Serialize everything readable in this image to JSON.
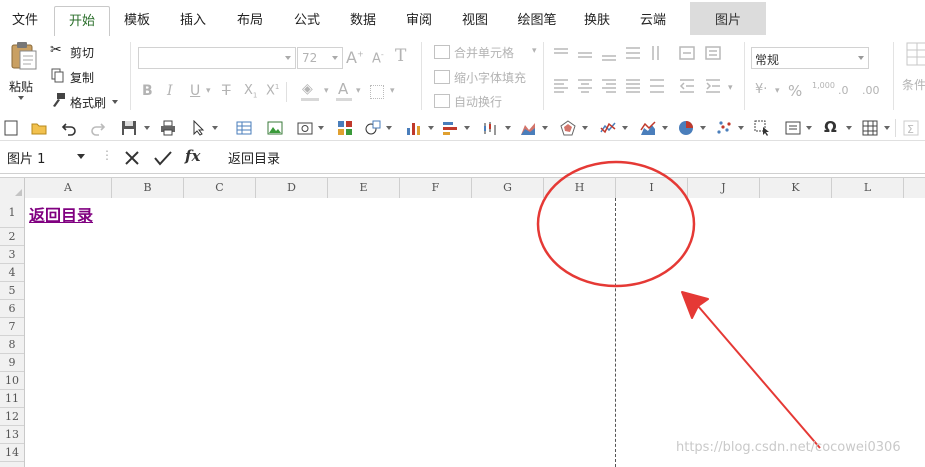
{
  "tabs": [
    {
      "label": "文件",
      "active": false
    },
    {
      "label": "开始",
      "active": true
    },
    {
      "label": "模板",
      "active": false
    },
    {
      "label": "插入",
      "active": false
    },
    {
      "label": "布局",
      "active": false
    },
    {
      "label": "公式",
      "active": false
    },
    {
      "label": "数据",
      "active": false
    },
    {
      "label": "审阅",
      "active": false
    },
    {
      "label": "视图",
      "active": false
    },
    {
      "label": "绘图笔",
      "active": false
    },
    {
      "label": "换肤",
      "active": false
    },
    {
      "label": "云端",
      "active": false
    }
  ],
  "context_tab": "图片",
  "clipboard": {
    "paste": "粘贴",
    "cut": "剪切",
    "copy": "复制",
    "format_painter": "格式刷"
  },
  "font": {
    "size_placeholder": "72"
  },
  "alignment": {
    "merge": "合并单元格",
    "shrink": "缩小字体填充",
    "wrap": "自动换行"
  },
  "number": {
    "format": "常规",
    "percent": "%",
    "thousands": "1,000",
    "inc_decimal": ".0",
    "dec_decimal": ".00"
  },
  "styles": {
    "conditional": "条件"
  },
  "formula_bar": {
    "name_box": "图片 1",
    "fx": "fx",
    "content": "返回目录"
  },
  "columns": [
    "A",
    "B",
    "C",
    "D",
    "E",
    "F",
    "G",
    "H",
    "I",
    "J",
    "K",
    "L"
  ],
  "rows": [
    "1",
    "2",
    "3",
    "4",
    "5",
    "6",
    "7",
    "8",
    "9",
    "10",
    "11",
    "12",
    "13",
    "14"
  ],
  "cells": {
    "A1": "返回目录"
  },
  "watermark": "https://blog.csdn.net/cocowei0306",
  "colors": {
    "accent_green": "#2a6e2a",
    "hyperlink": "#800080",
    "annotation_red": "#e53935"
  }
}
